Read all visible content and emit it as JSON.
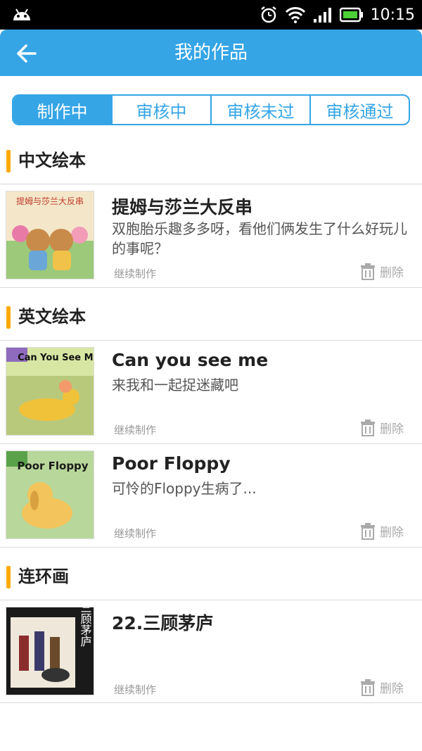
{
  "status_bar": {
    "time": "10:15"
  },
  "app_bar": {
    "title": "我的作品"
  },
  "tabs": [
    {
      "label": "制作中",
      "active": true
    },
    {
      "label": "审核中",
      "active": false
    },
    {
      "label": "审核未过",
      "active": false
    },
    {
      "label": "审核通过",
      "active": false
    }
  ],
  "sections": [
    {
      "label": "中文绘本",
      "items": [
        {
          "title": "提姆与莎兰大反串",
          "desc": "双胞胎乐趣多多呀，看他们俩发生了什么好玩儿的事呢？",
          "continue": "继续制作",
          "delete": "删除",
          "cover_text": "提姆与莎兰大反串"
        }
      ]
    },
    {
      "label": "英文绘本",
      "items": [
        {
          "title": "Can you see me",
          "desc": "来我和一起捉迷藏吧",
          "continue": "继续制作",
          "delete": "删除",
          "cover_text": "Can You See Me?"
        },
        {
          "title": "Poor Floppy",
          "desc": "可怜的Floppy生病了...",
          "continue": "继续制作",
          "delete": "删除",
          "cover_text": "Poor Floppy"
        }
      ]
    },
    {
      "label": "连环画",
      "items": [
        {
          "title": "22.三顾茅庐",
          "desc": "",
          "continue": "继续制作",
          "delete": "删除",
          "cover_text": "三顾茅庐"
        }
      ]
    }
  ],
  "colors": {
    "primary": "#35a5e6",
    "accent": "#ffaa00"
  }
}
